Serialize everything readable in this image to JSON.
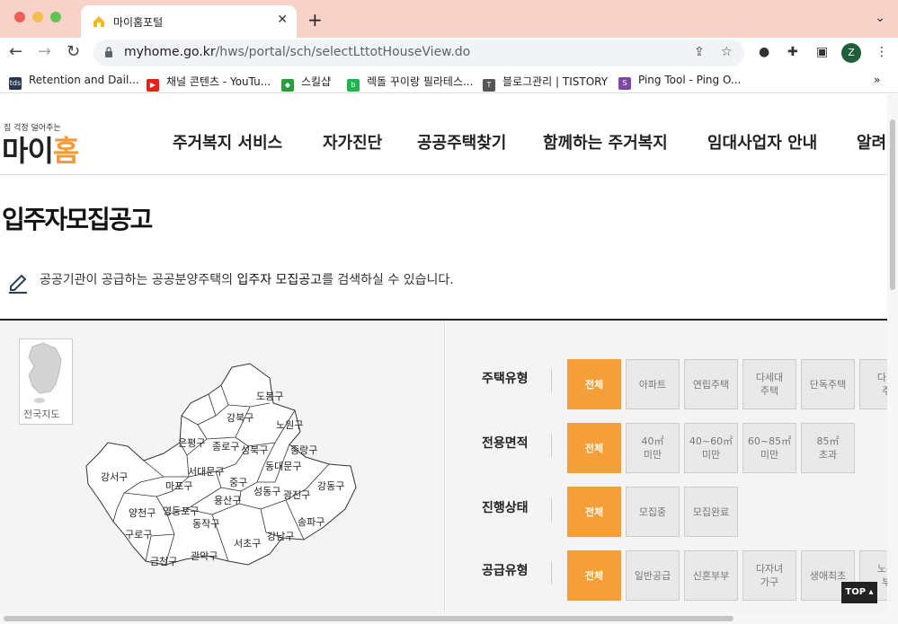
{
  "browser": {
    "tab_title": "마이홈포털",
    "url_domain": "myhome.go.kr",
    "url_path": "/hws/portal/sch/selectLttotHouseView.do",
    "profile_initial": "Z",
    "bookmarks": [
      {
        "label": "Retention and Dail...",
        "icon": "tds",
        "color": "#27364a"
      },
      {
        "label": "채널 콘텐츠 - YouTu...",
        "icon": "youtube-icon",
        "color": "#e62117"
      },
      {
        "label": "스킬샵",
        "icon": "skillshop-icon",
        "color": "#2a9d3c"
      },
      {
        "label": "렉돌 꾸이랑 필라테스...",
        "icon": "blog",
        "color": "#21b54f"
      },
      {
        "label": "블로그관리 | TISTORY",
        "icon": "tistory-icon",
        "color": "#555555"
      },
      {
        "label": "Ping Tool - Ping O...",
        "icon": "sst",
        "color": "#7a4aa5"
      }
    ]
  },
  "site": {
    "logo_tagline": "집 걱정 덜어주는",
    "logo_text_1": "마이",
    "logo_text_2": "홈",
    "nav": [
      "주거복지 서비스",
      "자가진단",
      "공공주택찾기",
      "함께하는 주거복지",
      "임대사업자 안내",
      "알려"
    ],
    "nav_active": "공공주택찾기"
  },
  "main": {
    "title": "입주자모집공고",
    "desc_before": "공공기관이 공급하는 공공분양주택의 ",
    "desc_bold": "입주자 모집공고",
    "desc_after": "를 검색하실 수 있습니다.",
    "korea_map_label": "전국지도",
    "districts": [
      "도봉구",
      "강북구",
      "노원구",
      "은평구",
      "종로구",
      "성북구",
      "중랑구",
      "동대문구",
      "서대문구",
      "강서구",
      "마포구",
      "중구",
      "성동구",
      "광진구",
      "강동구",
      "용산구",
      "양천구",
      "영등포구",
      "동작구",
      "송파구",
      "구로구",
      "강남구",
      "서초구",
      "금천구",
      "관악구"
    ]
  },
  "filters": [
    {
      "label": "주택유형",
      "options": [
        "전체",
        "아파트",
        "연립주택",
        "다세대\n주택",
        "단독주택",
        "다가\n주"
      ]
    },
    {
      "label": "전용면적",
      "options": [
        "전체",
        "40㎡\n미만",
        "40~60㎡\n미만",
        "60~85㎡\n미만",
        "85㎡\n초과"
      ]
    },
    {
      "label": "진행상태",
      "options": [
        "전체",
        "모집중",
        "모집완료"
      ]
    },
    {
      "label": "공급유형",
      "options": [
        "전체",
        "일반공급",
        "신혼부부",
        "다자녀\n가구",
        "생애최초",
        "노부\n부"
      ]
    }
  ],
  "top_button": "TOP ▴",
  "colors": {
    "accent": "#f59f3b",
    "highlight": "#f9d23a",
    "tabbar": "#f6d2c8"
  }
}
